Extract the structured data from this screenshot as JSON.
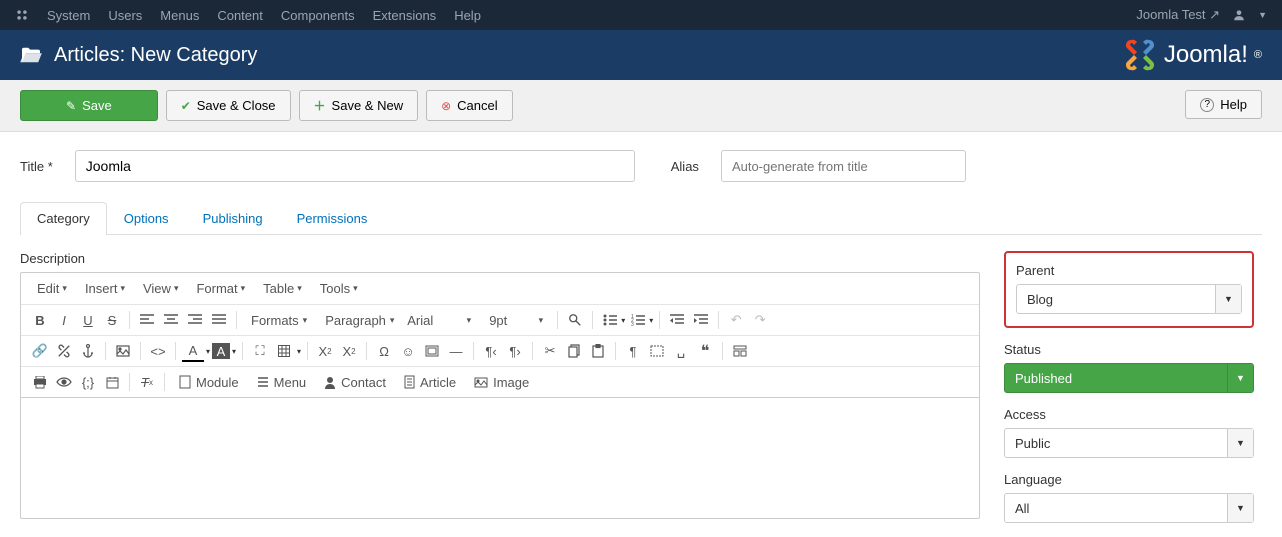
{
  "topnav": {
    "items": [
      "System",
      "Users",
      "Menus",
      "Content",
      "Components",
      "Extensions",
      "Help"
    ],
    "site_name": "Joomla Test"
  },
  "header": {
    "title": "Articles: New Category",
    "brand": "Joomla!"
  },
  "toolbar": {
    "save": "Save",
    "save_close": "Save & Close",
    "save_new": "Save & New",
    "cancel": "Cancel",
    "help": "Help"
  },
  "form": {
    "title_label": "Title *",
    "title_value": "Joomla",
    "alias_label": "Alias",
    "alias_placeholder": "Auto-generate from title"
  },
  "tabs": [
    "Category",
    "Options",
    "Publishing",
    "Permissions"
  ],
  "active_tab": 0,
  "editor": {
    "description_label": "Description",
    "menus": [
      "Edit",
      "Insert",
      "View",
      "Format",
      "Table",
      "Tools"
    ],
    "format_dd": "Formats",
    "block_dd": "Paragraph",
    "font_dd": "Arial",
    "size_dd": "9pt",
    "media_buttons": {
      "module": "Module",
      "menu": "Menu",
      "contact": "Contact",
      "article": "Article",
      "image": "Image"
    }
  },
  "sidebar": {
    "parent": {
      "label": "Parent",
      "value": "Blog"
    },
    "status": {
      "label": "Status",
      "value": "Published"
    },
    "access": {
      "label": "Access",
      "value": "Public"
    },
    "language": {
      "label": "Language",
      "value": "All"
    }
  }
}
